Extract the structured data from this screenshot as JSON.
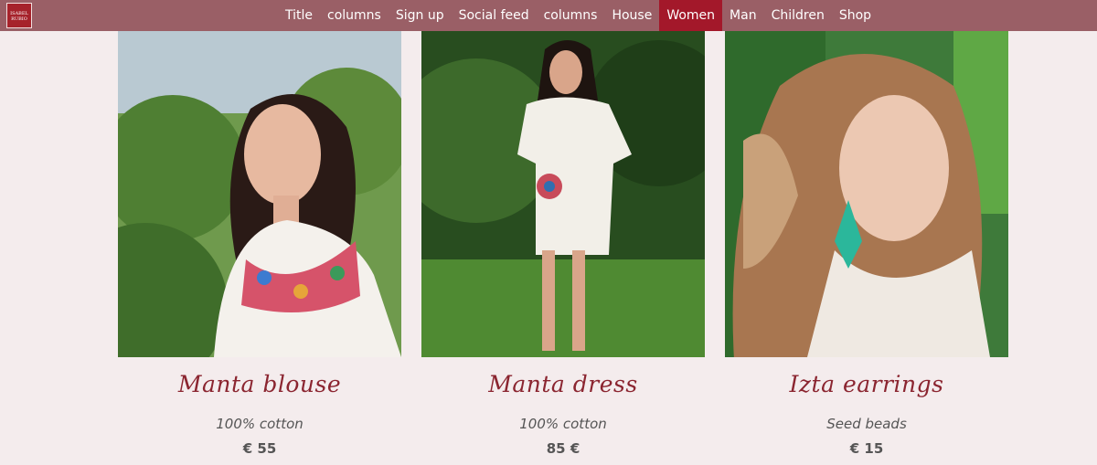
{
  "logo": {
    "text": "ISABEL RUBIO"
  },
  "nav": {
    "items": [
      {
        "label": "Title"
      },
      {
        "label": "columns"
      },
      {
        "label": "Sign up"
      },
      {
        "label": "Social feed"
      },
      {
        "label": "columns"
      },
      {
        "label": "House"
      },
      {
        "label": "Women"
      },
      {
        "label": "Man"
      },
      {
        "label": "Children"
      },
      {
        "label": "Shop"
      }
    ],
    "active": "Women",
    "active_color": "#a3182a",
    "bar_color": "#9a5f66"
  },
  "products": [
    {
      "name": "Manta blouse",
      "material": "100% cotton",
      "price": "€ 55",
      "image_icon": "woman-blouse-photo"
    },
    {
      "name": "Manta dress",
      "material": "100% cotton",
      "price": "85 €",
      "image_icon": "woman-dress-photo"
    },
    {
      "name": "Izta earrings",
      "material": "Seed beads",
      "price": "€ 15",
      "image_icon": "woman-earrings-photo"
    }
  ],
  "colors": {
    "background": "#f4eced",
    "title": "#8b2530",
    "text": "#555555"
  }
}
